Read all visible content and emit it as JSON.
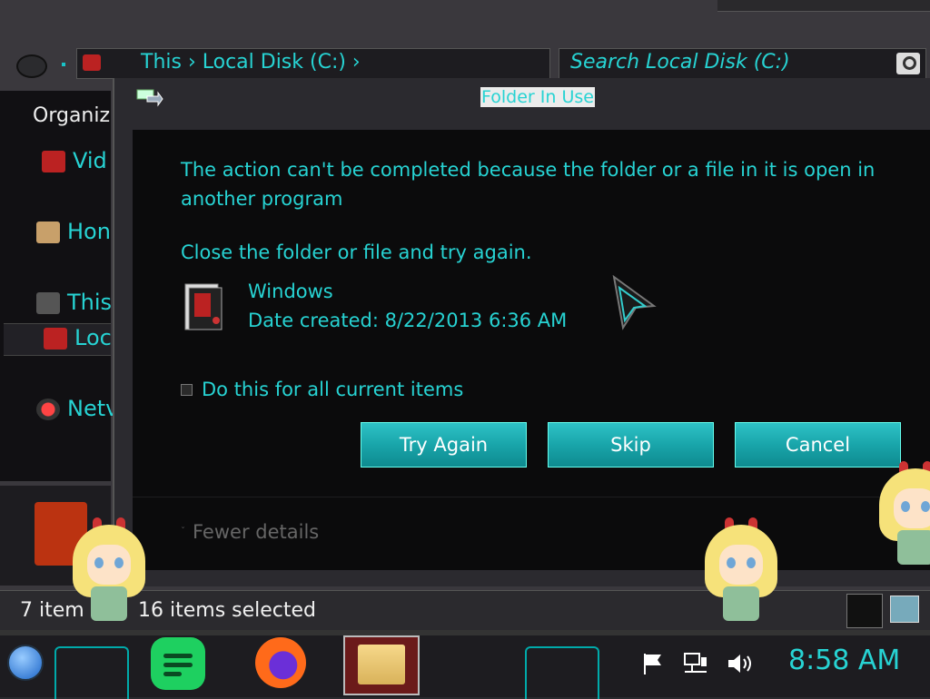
{
  "explorer": {
    "address_text": "This   ›   Local Disk (C:)   ›",
    "search_placeholder": "Search Local Disk (C:)",
    "organize_label": "Organiz",
    "nav_items": [
      {
        "label": "Vid",
        "icon": "videos-folder-icon"
      },
      {
        "label": "Hon",
        "icon": "homegroup-icon"
      },
      {
        "label": "This",
        "icon": "this-pc-icon"
      },
      {
        "label": "Loc",
        "icon": "local-disk-icon"
      },
      {
        "label": "Netv",
        "icon": "network-icon"
      }
    ],
    "status_item_count": "7 item",
    "status_selected": "16 items selected"
  },
  "dialog": {
    "title": "Folder In Use",
    "message": "The action can't be completed because the folder or a file in it is open in another program",
    "hint": "Close the folder or file and try again.",
    "file_name": "Windows",
    "file_date": "Date created: 8/22/2013 6:36 AM",
    "checkbox_label": "Do this for all current items",
    "checkbox_checked": false,
    "buttons": {
      "try_again": "Try Again",
      "skip": "Skip",
      "cancel": "Cancel"
    },
    "details_toggle": "Fewer details"
  },
  "taskbar": {
    "clock": "8:58 AM",
    "apps": [
      "notes-app-icon",
      "firefox-icon",
      "file-explorer-icon"
    ],
    "tray": [
      "flag-icon",
      "network-icon",
      "volume-icon"
    ]
  },
  "colors": {
    "accent": "#27d3d3",
    "button": "#19a5aa",
    "dialog_bg": "#0b0b0c"
  }
}
